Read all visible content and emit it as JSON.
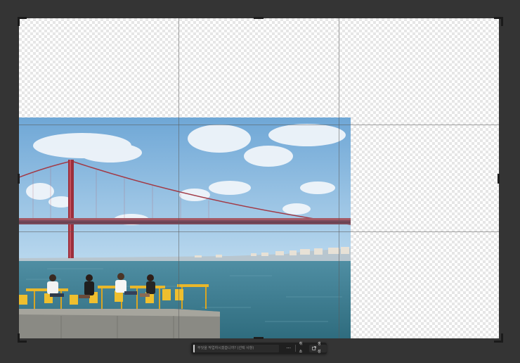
{
  "canvas": {
    "background": "#343434",
    "transparency_pattern": "checkerboard"
  },
  "photo": {
    "scene": "photograph",
    "colors": {
      "sky": "#9cc7e6",
      "water": "#3f7f91",
      "bridge": "#9c2f3c",
      "chairs": "#e9b72a"
    }
  },
  "taskbar": {
    "prompt_placeholder": "무엇을 작업하시겠습니까? (선택 사항)",
    "more_label": "···",
    "cancel_label": "취소",
    "generate_label": "생성",
    "generate_icon": "generate-icon"
  }
}
